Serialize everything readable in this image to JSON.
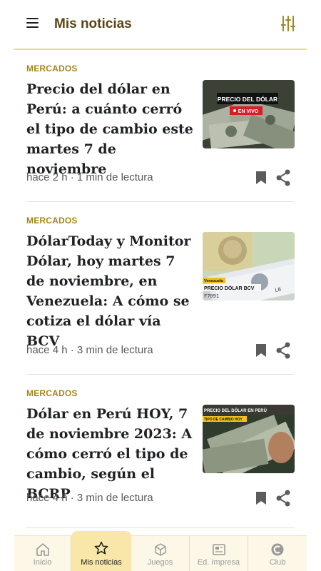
{
  "header": {
    "title": "Mis noticias",
    "menu_icon": "hamburger-menu-icon",
    "filter_icon": "sliders-icon"
  },
  "articles": [
    {
      "section": "MERCADOS",
      "headline": "Precio del dólar en Perú: a cuánto cerró el tipo de cambio este martes 7 de noviembre",
      "meta": "hace 2 h · 1 min de lectura",
      "thumb_title": "PRECIO DEL DÓLAR",
      "thumb_badge": "EN VIVO"
    },
    {
      "section": "MERCADOS",
      "headline": "DólarToday y Monitor Dólar, hoy martes 7 de noviembre, en Venezuela: A cómo se cotiza el dólar vía BCV",
      "meta": "hace 4 h · 3 min de lectura",
      "thumb_tag": "Venezuela",
      "thumb_title": "PRECIO DÓLAR BCV"
    },
    {
      "section": "MERCADOS",
      "headline": "Dólar en Perú HOY, 7 de noviembre 2023: A cómo cerró el tipo de cambio, según el BCRP",
      "meta": "hace 4 h · 3 min de lectura",
      "thumb_title": "PRECIO DEL DÓLAR EN PERÚ",
      "thumb_tag": "TIPO DE CAMBIO HOY"
    }
  ],
  "nav": [
    {
      "label": "Inicio",
      "icon": "home-icon"
    },
    {
      "label": "Mis noticias",
      "icon": "star-icon",
      "active": true
    },
    {
      "label": "Juegos",
      "icon": "cube-icon"
    },
    {
      "label": "Ed. Impresa",
      "icon": "newspaper-icon"
    },
    {
      "label": "Club",
      "icon": "club-icon"
    }
  ],
  "colors": {
    "accent": "#a6851e",
    "title": "#5a4514",
    "nav_bg": "#fcf7e6",
    "nav_active": "#f8e7a8",
    "divider": "#f1d98a"
  }
}
